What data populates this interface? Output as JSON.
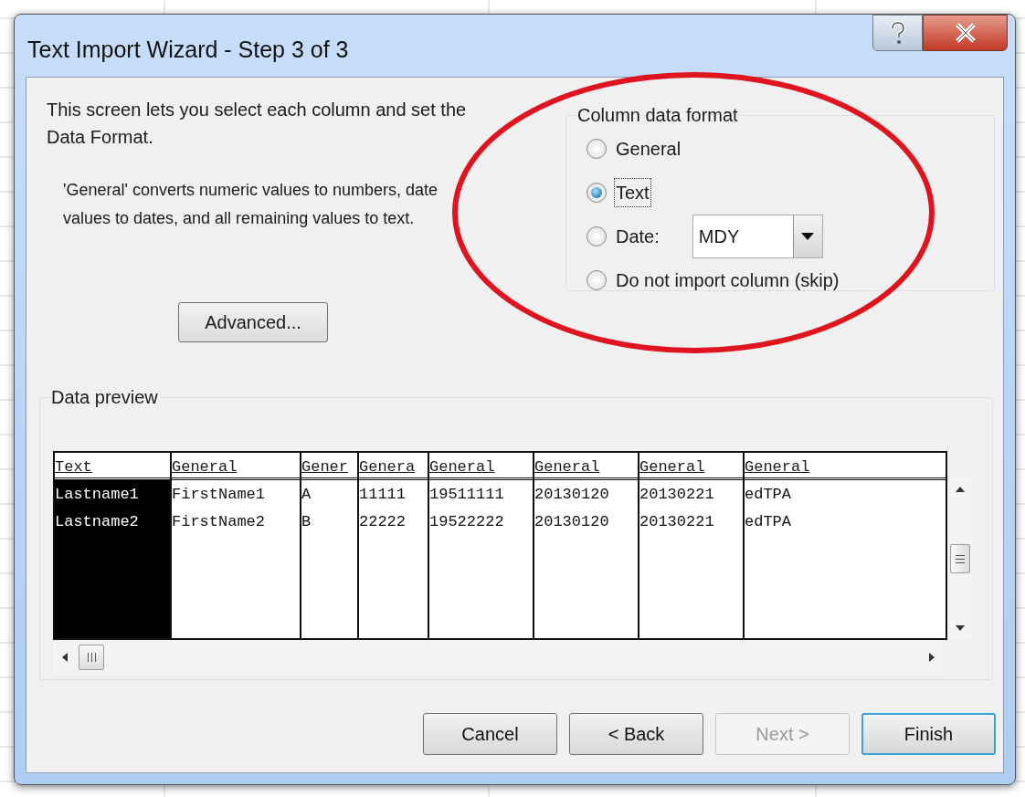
{
  "window": {
    "title": "Text Import Wizard - Step 3 of 3"
  },
  "description": "This screen lets you select each column and set the Data Format.",
  "note": "'General' converts numeric values to numbers, date values to dates, and all remaining values to text.",
  "advanced_button": "Advanced...",
  "column_data_format": {
    "title": "Column data format",
    "date_format": "MDY",
    "options": [
      {
        "label": "General",
        "selected": false,
        "focused": false
      },
      {
        "label": "Text",
        "selected": true,
        "focused": true
      },
      {
        "label": "Date:",
        "selected": false,
        "focused": false
      },
      {
        "label": "Do not import column (skip)",
        "selected": false,
        "focused": false
      }
    ]
  },
  "data_preview": {
    "title": "Data preview",
    "columns": [
      {
        "heading": "Text",
        "selected": true,
        "cells": [
          "Lastname1",
          "Lastname2"
        ]
      },
      {
        "heading": "General",
        "selected": false,
        "cells": [
          "FirstName1",
          "FirstName2"
        ]
      },
      {
        "heading": "Gener",
        "selected": false,
        "cells": [
          "A",
          "B"
        ]
      },
      {
        "heading": "Genera",
        "selected": false,
        "cells": [
          "11111",
          "22222"
        ]
      },
      {
        "heading": "General",
        "selected": false,
        "cells": [
          "19511111",
          "19522222"
        ]
      },
      {
        "heading": "General",
        "selected": false,
        "cells": [
          "20130120",
          "20130120"
        ]
      },
      {
        "heading": "General",
        "selected": false,
        "cells": [
          "20130221",
          "20130221"
        ]
      },
      {
        "heading": "General",
        "selected": false,
        "cells": [
          "edTPA",
          "edTPA"
        ]
      }
    ]
  },
  "buttons": [
    {
      "label": "Cancel",
      "disabled": false,
      "default": false
    },
    {
      "label": "< Back",
      "disabled": false,
      "default": false
    },
    {
      "label": "Next >",
      "disabled": true,
      "default": false
    },
    {
      "label": "Finish",
      "disabled": false,
      "default": true
    }
  ]
}
